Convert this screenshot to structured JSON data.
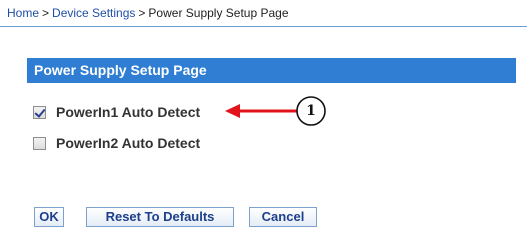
{
  "breadcrumb": {
    "home": "Home",
    "sep1": ">",
    "device_settings": "Device Settings",
    "sep2": ">",
    "current": "Power Supply Setup Page"
  },
  "panel": {
    "title": "Power Supply Setup Page"
  },
  "options": [
    {
      "label": "PowerIn1 Auto Detect",
      "checked": true
    },
    {
      "label": "PowerIn2 Auto Detect",
      "checked": false
    }
  ],
  "callout": {
    "number": "1",
    "color": "#e2141b"
  },
  "buttons": {
    "ok": "OK",
    "reset": "Reset To Defaults",
    "cancel": "Cancel"
  },
  "colors": {
    "header_bg": "#2f7ed3",
    "link": "#1f4fa8",
    "button_text": "#1e3f8c"
  }
}
